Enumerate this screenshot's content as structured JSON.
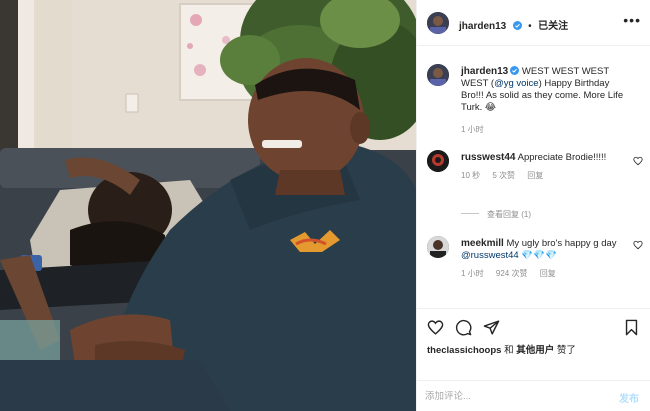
{
  "post": {
    "author": "jharden13",
    "follow_status": "已关注",
    "separator": "•",
    "more_icon": "more-horizontal-icon"
  },
  "caption": {
    "username": "jharden13",
    "text_before": "WEST WEST WEST WEST (",
    "mention": "@yg voice",
    "text_after": ") Happy Birthday Bro!!! As solid as they come. More Life Turk. 😂",
    "time": "1 小时"
  },
  "comments": [
    {
      "username": "russwest44",
      "text": "Appreciate Brodie!!!!!",
      "time": "10 秒",
      "likes": "5 次赞",
      "reply": "回复"
    },
    {
      "username": "meekmill",
      "text_before": "My ugly bro's happy g day ",
      "mention": "@russwest44",
      "text_after": " 💎💎💎",
      "time": "1 小时",
      "likes": "924 次赞",
      "reply": "回复"
    }
  ],
  "view_replies": "查看回复 (1)",
  "likes_line": {
    "user": "theclassichoops",
    "conj": " 和 ",
    "others": "其他用户",
    "suffix": " 赞了"
  },
  "comment_box": {
    "placeholder": "添加评论...",
    "post_label": "发布"
  },
  "icons": [
    "heart-icon",
    "comment-icon",
    "share-icon",
    "bookmark-icon",
    "verified-badge-icon"
  ],
  "colors": {
    "verified": "#3897f0",
    "mention": "#00376b",
    "muted": "#8e8e8e",
    "post_button": "#b2dffc"
  }
}
